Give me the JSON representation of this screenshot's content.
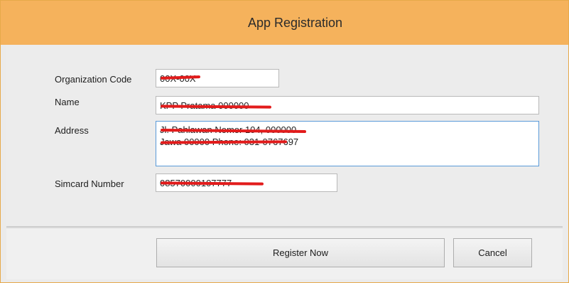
{
  "window": {
    "title": "App Registration"
  },
  "form": {
    "organization_code": {
      "label": "Organization Code",
      "value": "00X-00X"
    },
    "name": {
      "label": "Name",
      "value": "KPP Pratama 000000"
    },
    "address": {
      "label": "Address",
      "line1": "Jl. Pahlawan Nomor 104, 000000",
      "line2": "Jawa 00000 Phone: 031-0767697"
    },
    "simcard_number": {
      "label": "Simcard Number",
      "value": "08570000107777"
    }
  },
  "buttons": {
    "register": "Register Now",
    "cancel": "Cancel"
  },
  "colors": {
    "titlebar": "#f5b25c",
    "redaction": "#e21b1b",
    "focus_border": "#5a9ad8"
  }
}
